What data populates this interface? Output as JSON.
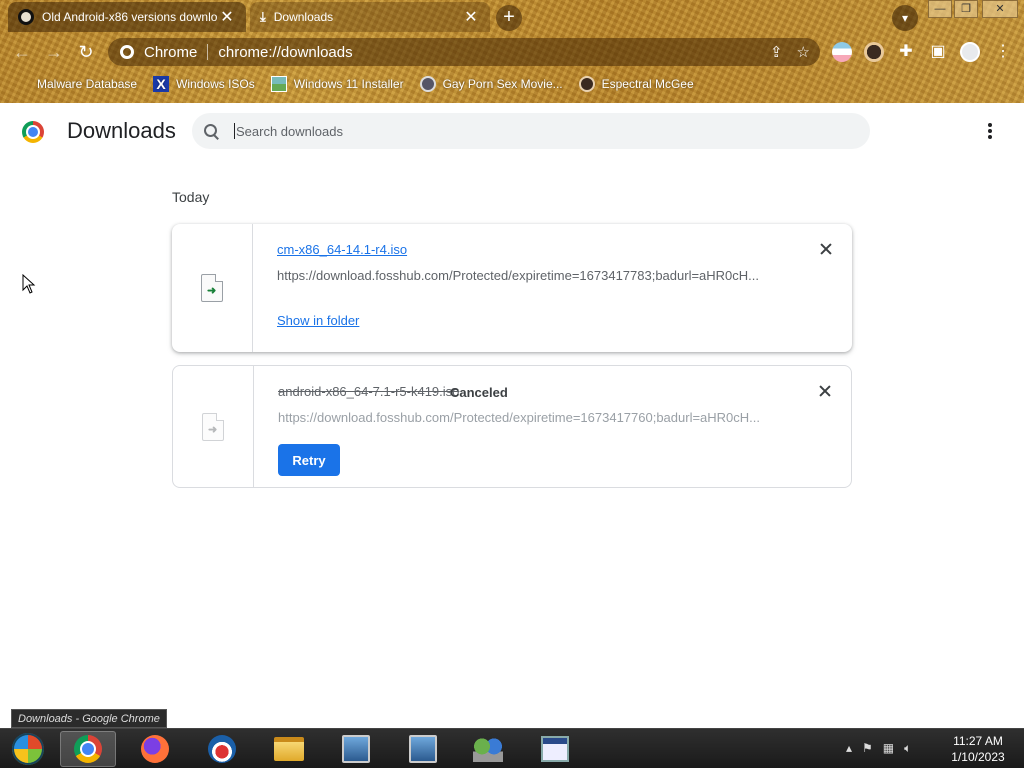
{
  "browser": {
    "tabs": [
      {
        "title": "Old Android-x86 versions downlo",
        "favicon": "q-logo-icon",
        "active": false
      },
      {
        "title": "Downloads",
        "favicon": "download-icon",
        "active": true
      }
    ],
    "omnibox": {
      "site_label": "Chrome",
      "url": "chrome://downloads"
    },
    "bookmarks": [
      {
        "label": "Malware Database",
        "icon": "bookmark-plain-icon"
      },
      {
        "label": "Windows ISOs",
        "icon": "x-logo-icon"
      },
      {
        "label": "Windows 11 Installer",
        "icon": "image-icon"
      },
      {
        "label": "Gay Porn Sex Movie...",
        "icon": "globe-icon"
      },
      {
        "label": "Espectral McGee",
        "icon": "face-icon"
      }
    ]
  },
  "downloads_page": {
    "title": "Downloads",
    "search_placeholder": "Search downloads",
    "date_header": "Today",
    "items": [
      {
        "file_name": "cm-x86_64-14.1-r4.iso",
        "url": "https://download.fosshub.com/Protected/expiretime=1673417783;badurl=aHR0cH...",
        "action_label": "Show in folder",
        "status": ""
      },
      {
        "file_name": "android-x86_64-7.1-r5-k419.iso",
        "url": "https://download.fosshub.com/Protected/expiretime=1673417760;badurl=aHR0cH...",
        "action_label": "Retry",
        "status": "Canceled"
      }
    ]
  },
  "tooltip": "Downloads - Google Chrome",
  "taskbar": {
    "time": "11:27 AM",
    "date": "1/10/2023"
  },
  "colors": {
    "link_blue": "#1a73e8",
    "retry_button": "#1a73e8"
  }
}
